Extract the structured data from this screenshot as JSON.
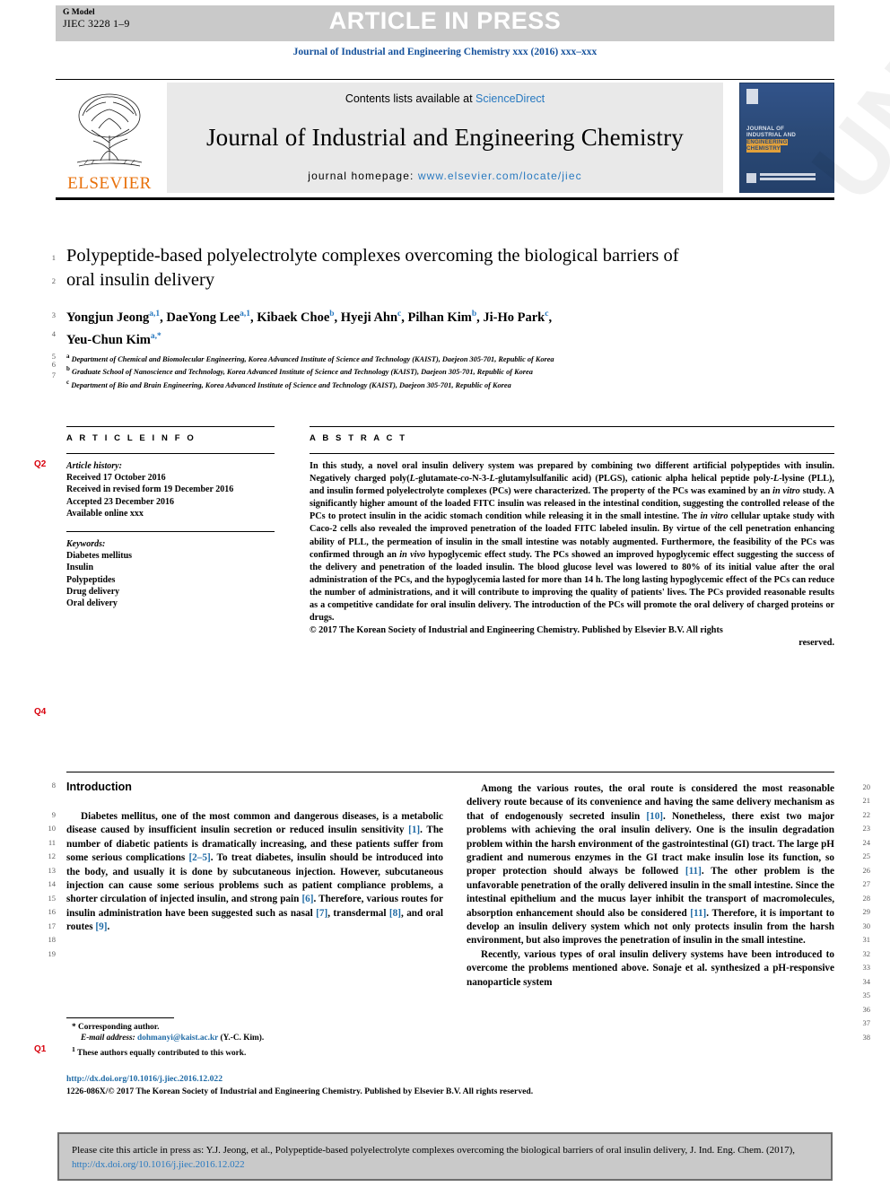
{
  "banner": {
    "g_model_label": "G Model",
    "manuscript_id": "JIEC 3228 1–9",
    "article_in_press": "ARTICLE IN PRESS",
    "runhead": "Journal of Industrial and Engineering Chemistry xxx (2016) xxx–xxx"
  },
  "masthead": {
    "publisher": "ELSEVIER",
    "contents_prefix": "Contents lists available at ",
    "contents_link": "ScienceDirect",
    "journal_title": "Journal of Industrial and Engineering Chemistry",
    "homepage_label": "journal homepage: ",
    "homepage_url": "www.elsevier.com/locate/jiec",
    "cover_text": "JOURNAL OF INDUSTRIAL AND ENGINEERING CHEMISTRY"
  },
  "article": {
    "title": "Polypeptide-based polyelectrolyte complexes overcoming the biological barriers of oral insulin delivery",
    "authors_line1": "Yongjun Jeong",
    "authors": [
      {
        "name": "Yongjun Jeong",
        "sup": "a,1"
      },
      {
        "name": "DaeYong Lee",
        "sup": "a,1"
      },
      {
        "name": "Kibaek Choe",
        "sup": "b"
      },
      {
        "name": "Hyeji Ahn",
        "sup": "c"
      },
      {
        "name": "Pilhan Kim",
        "sup": "b"
      },
      {
        "name": "Ji-Ho Park",
        "sup": "c"
      },
      {
        "name": "Yeu-Chun Kim",
        "sup": "a,*"
      }
    ],
    "affiliations": [
      {
        "mark": "a",
        "text": "Department of Chemical and Biomolecular Engineering, Korea Advanced Institute of Science and Technology (KAIST), Daejeon 305-701, Republic of Korea"
      },
      {
        "mark": "b",
        "text": "Graduate School of Nanoscience and Technology, Korea Advanced Institute of Science and Technology (KAIST), Daejeon 305-701, Republic of Korea"
      },
      {
        "mark": "c",
        "text": "Department of Bio and Brain Engineering, Korea Advanced Institute of Science and Technology (KAIST), Daejeon 305-701, Republic of Korea"
      }
    ]
  },
  "article_info": {
    "heading": "A R T I C L E   I N F O",
    "history_label": "Article history:",
    "history": [
      "Received 17 October 2016",
      "Received in revised form 19 December 2016",
      "Accepted 23 December 2016",
      "Available online xxx"
    ],
    "keywords_label": "Keywords:",
    "keywords": [
      "Diabetes mellitus",
      "Insulin",
      "Polypeptides",
      "Drug delivery",
      "Oral delivery"
    ]
  },
  "abstract": {
    "heading": "A B S T R A C T",
    "p1_a": "In this study, a novel oral insulin delivery system was prepared by combining two different artificial polypeptides with insulin. Negatively charged poly(",
    "p1_it1": "L",
    "p1_b": "-glutamate-",
    "p1_it2": "co",
    "p1_c": "-N-3-",
    "p1_it3": "L",
    "p1_d": "-glutamylsulfanilic acid) (PLGS), cationic alpha helical peptide poly-",
    "p1_it4": "L",
    "p1_e": "-lysine (PLL), and insulin formed polyelectrolyte complexes (PCs) were characterized. The property of the PCs was examined by an ",
    "p1_it5": "in vitro",
    "p1_f": " study. A significantly higher amount of the loaded FITC insulin was released in the intestinal condition, suggesting the controlled release of the PCs to protect insulin in the acidic stomach condition while releasing it in the small intestine. The ",
    "p1_it6": "in vitro",
    "p1_g": " cellular uptake study with Caco-2 cells also revealed the improved penetration of the loaded FITC labeled insulin. By virtue of the cell penetration enhancing ability of PLL, the permeation of insulin in the small intestine was notably augmented. Furthermore, the feasibility of the PCs was confirmed through an ",
    "p1_it7": "in vivo",
    "p1_h": " hypoglycemic effect study. The PCs showed an improved hypoglycemic effect suggesting the success of the delivery and penetration of the loaded insulin. The blood glucose level was lowered to 80% of its initial value after the oral administration of the PCs, and the hypoglycemia lasted for more than 14 h. The long lasting hypoglycemic effect of the PCs can reduce the number of administrations, and it will contribute to improving the quality of patients' lives. The PCs provided reasonable results as a competitive candidate for oral insulin delivery. The introduction of the PCs will promote the oral delivery of charged proteins or drugs.",
    "copyright": "© 2017 The Korean Society of Industrial and Engineering Chemistry. Published by Elsevier B.V. All rights",
    "copyright_tail": "reserved."
  },
  "body": {
    "section_heading": "Introduction",
    "left_p1_a": "Diabetes mellitus, one of the most common and dangerous diseases, is a metabolic disease caused by insufficient insulin secretion or reduced insulin sensitivity ",
    "ref1": "[1]",
    "left_p1_b": ". The number of diabetic patients is dramatically increasing, and these patients suffer from some serious complications ",
    "ref2": "[2–5]",
    "left_p1_c": ". To treat diabetes, insulin should be introduced into the body, and usually it is done by subcutaneous injection. However, subcutaneous injection can cause some serious problems such as patient compliance problems, a shorter circulation of injected insulin, and strong pain ",
    "ref3": "[6]",
    "left_p1_d": ". Therefore, various routes for insulin administration have been suggested such as nasal ",
    "ref4": "[7]",
    "left_p1_e": ", transdermal ",
    "ref5": "[8]",
    "left_p1_f": ", and oral routes ",
    "ref6": "[9]",
    "left_p1_g": ".",
    "right_p1_a": "Among the various routes, the oral route is considered the most reasonable delivery route because of its convenience and having the same delivery mechanism as that of endogenously secreted insulin ",
    "ref7": "[10]",
    "right_p1_b": ". Nonetheless, there exist two major problems with achieving the oral insulin delivery. One is the insulin degradation problem within the harsh environment of the gastrointestinal (GI) tract. The large pH gradient and numerous enzymes in the GI tract make insulin lose its function, so proper protection should always be followed ",
    "ref8": "[11]",
    "right_p1_c": ". The other problem is the unfavorable penetration of the orally delivered insulin in the small intestine. Since the intestinal epithelium and the mucus layer inhibit the transport of macromolecules, absorption enhancement should also be considered ",
    "ref9": "[11]",
    "right_p1_d": ". Therefore, it is important to develop an insulin delivery system which not only protects insulin from the harsh environment, but also improves the penetration of insulin in the small intestine.",
    "right_p2": "Recently, various types of oral insulin delivery systems have been introduced to overcome the problems mentioned above. Sonaje et al. synthesized a pH-responsive nanoparticle system"
  },
  "footnotes": {
    "corresponding": "Corresponding author.",
    "email_label": "E-mail address:",
    "email": "dohmanyi@kaist.ac.kr",
    "email_owner": "(Y.-C. Kim).",
    "equal_contrib": "These authors equally contributed to this work.",
    "doi": "http://dx.doi.org/10.1016/j.jiec.2016.12.022",
    "issn_line": "1226-086X/© 2017 The Korean Society of Industrial and Engineering Chemistry. Published by Elsevier B.V. All rights reserved."
  },
  "cite_box": {
    "text": "Please cite this article in press as: Y.J. Jeong, et al., Polypeptide-based polyelectrolyte complexes overcoming the biological barriers of oral insulin delivery, J. Ind. Eng. Chem. (2017), ",
    "link": "http://dx.doi.org/10.1016/j.jiec.2016.12.022"
  },
  "queries": [
    {
      "label": "Q2"
    },
    {
      "label": "Q4"
    },
    {
      "label": "Q1"
    }
  ],
  "line_numbers": {
    "title_block": [
      "1",
      "2",
      "3",
      "4",
      "5",
      "6",
      "7"
    ],
    "left_column": [
      "8",
      "9",
      "10",
      "11",
      "12",
      "13",
      "14",
      "15",
      "16",
      "17",
      "18",
      "19"
    ],
    "right_column": [
      "20",
      "21",
      "22",
      "23",
      "24",
      "25",
      "26",
      "27",
      "28",
      "29",
      "30",
      "31",
      "32",
      "33",
      "34",
      "35",
      "36",
      "37",
      "38"
    ]
  },
  "colors": {
    "link": "#2879c0",
    "ref": "#1f6aa5",
    "query": "#d8000c",
    "banner": "#c9c9c9",
    "elsevier_orange": "#E8700A"
  },
  "watermark": "UNCORRECTED PROOF"
}
